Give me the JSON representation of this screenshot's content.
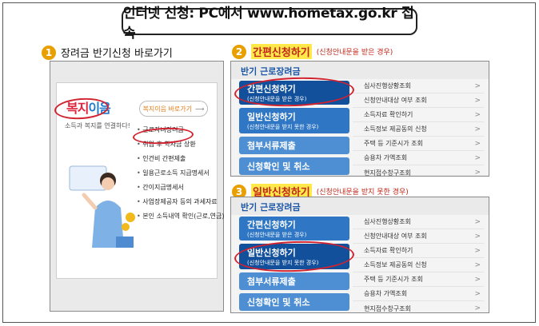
{
  "title": "인터넷 신청:  PC에서 www.hometax.go.kr 접속",
  "step1": {
    "num": "1",
    "label": "장려금 반기신청 바로가기"
  },
  "step2": {
    "num": "2",
    "label": "간편신청하기",
    "note": "(신청안내문을 받은 경우)"
  },
  "step3": {
    "num": "3",
    "label": "일반신청하기",
    "note": "(신청안내문을 받지 못한 경우)"
  },
  "left_panel": {
    "logo_a": "복지",
    "logo_b": "이음",
    "tagline": "소득과 복지를 연결하다!",
    "shortcut": "복지이음 바로가기",
    "shortcut_arrow": "⟶",
    "menu": [
      "근로자녀장려금",
      "취업 후 학자금 상환",
      "인건비 간편제출",
      "일용근로소득 지급명세서",
      "간이지급명세서",
      "사업장제공자 등의 과세자료",
      "본인 소득내역 확인(근로,연금)"
    ]
  },
  "panel": {
    "heading": "반기 근로장려금",
    "buttons": [
      {
        "main": "간편신청하기",
        "sub": "(신청안내문을 받은 경우)"
      },
      {
        "main": "일반신청하기",
        "sub": "(신청안내문을 받지 못한 경우)"
      },
      {
        "main": "첨부서류제출"
      },
      {
        "main": "신청확인 및 취소"
      }
    ],
    "side": [
      "심사진행상황조회",
      "신청안내대상 여부 조회",
      "소득자료 확인하기",
      "소득정보 제공동의 신청",
      "주택 등 기준시가 조회",
      "승용차 가액조회",
      "현지접수창구조회"
    ],
    "chevron": ">"
  }
}
